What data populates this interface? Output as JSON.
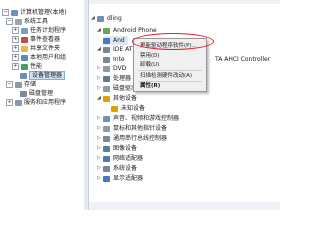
{
  "colors": {
    "accent": "#e0202a",
    "selection": "#cfe3f7",
    "folder": "#e8b84a",
    "device": "#4a78b8"
  },
  "left_tree": {
    "root": "计算机管理(本地)",
    "system_tools": "系统工具",
    "task_scheduler": "任务计划程序",
    "event_viewer": "事件查看器",
    "shared_folders": "共享文件夹",
    "local_users": "本地用户和组",
    "performance": "性能",
    "device_manager": "设备管理器",
    "storage": "存储",
    "disk_management": "磁盘管理",
    "services": "服务和应用程序"
  },
  "device_tree": {
    "computer": "dling",
    "android_phone": "Android Phone",
    "android_child": "And",
    "ide_group": "IDE AT",
    "intel_partial": "Inte",
    "sata_controller": "TA AHCI Controller",
    "dvd": "DVD",
    "cpu": "处理器",
    "disk": "磁盘驱动器",
    "other_devices": "其他设备",
    "unknown_device": "未知设备",
    "audio": "声音、视频和游戏控制器",
    "mouse": "鼠标和其他指针设备",
    "usb": "通用串行总线控制器",
    "imaging": "图像设备",
    "network": "网络适配器",
    "system_devices": "系统设备",
    "display": "显示适配器"
  },
  "context_menu": {
    "update_driver": "更新驱动程序软件(P)...",
    "disable": "禁用(D)",
    "uninstall": "卸载(U)",
    "scan": "扫描检测硬件改动(A)",
    "properties": "属性(R)"
  }
}
